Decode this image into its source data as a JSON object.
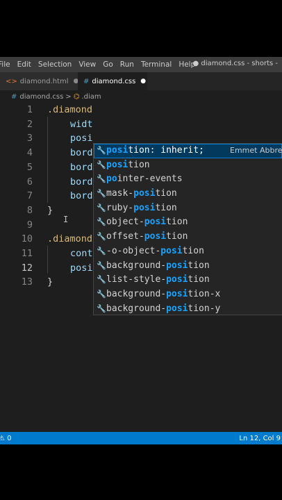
{
  "menu": [
    "File",
    "Edit",
    "Selection",
    "View",
    "Go",
    "Run",
    "Terminal",
    "Help"
  ],
  "window_title": "● diamond.css - shorts -",
  "tabs": [
    {
      "label": "diamond.html",
      "icon": "html-file-icon"
    },
    {
      "label": "diamond.css",
      "icon": "css-file-icon"
    }
  ],
  "breadcrumb": {
    "file": "diamond.css",
    "separator": ">",
    "symbol": ".diam"
  },
  "code_lines": [
    {
      "n": "1",
      "text": ".diamond"
    },
    {
      "n": "2",
      "text": "widt"
    },
    {
      "n": "3",
      "text": "posi"
    },
    {
      "n": "4",
      "text": "bord"
    },
    {
      "n": "5",
      "text": "bord"
    },
    {
      "n": "6",
      "text": "bord"
    },
    {
      "n": "7",
      "text": "bord"
    },
    {
      "n": "8",
      "text": "}"
    },
    {
      "n": "9",
      "text": ""
    },
    {
      "n": "10",
      "text": ".diamond"
    },
    {
      "n": "11",
      "text": "cont"
    },
    {
      "n": "12",
      "text": "posi"
    },
    {
      "n": "13",
      "text": "}"
    }
  ],
  "suggestions": [
    {
      "match": "posi",
      "rest": "tion: inherit;",
      "detail": "Emmet Abbre"
    },
    {
      "pre": "",
      "match": "posi",
      "rest": "tion"
    },
    {
      "pre": "",
      "match": "po",
      "rest": "inter-events"
    },
    {
      "pre": "mask-",
      "match": "posi",
      "rest": "tion"
    },
    {
      "pre": "ruby-",
      "match": "posi",
      "rest": "tion"
    },
    {
      "pre": "object-",
      "match": "posi",
      "rest": "tion"
    },
    {
      "pre": "offset-",
      "match": "posi",
      "rest": "tion"
    },
    {
      "pre": "-o-object-",
      "match": "posi",
      "rest": "tion"
    },
    {
      "pre": "background-",
      "match": "posi",
      "rest": "tion"
    },
    {
      "pre": "list-style-",
      "match": "posi",
      "rest": "tion"
    },
    {
      "pre": "background-",
      "match": "posi",
      "rest": "tion-x"
    },
    {
      "pre": "background-",
      "match": "posi",
      "rest": "tion-y"
    }
  ],
  "status": {
    "left": "⚠ 0",
    "right": "Ln 12, Col 9"
  },
  "colors": {
    "accent": "#007acc",
    "match": "#18a3ff",
    "selector": "#d7ba7d",
    "property": "#9cdcfe"
  }
}
